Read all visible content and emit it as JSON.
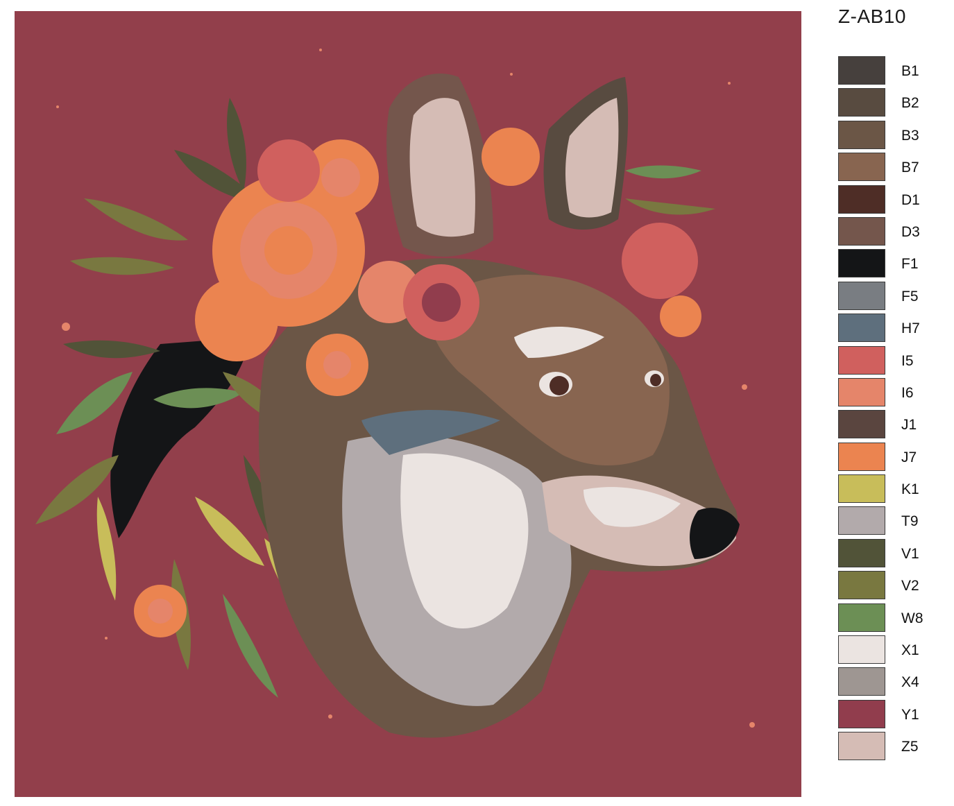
{
  "kit_code": "Z-AB10",
  "artwork": {
    "background_color": "#923f4b",
    "subject_icon": "wolf-with-flower-crown-illustration"
  },
  "palette": [
    {
      "code": "B1",
      "color": "#46403d"
    },
    {
      "code": "B2",
      "color": "#584b40"
    },
    {
      "code": "B3",
      "color": "#6b5646"
    },
    {
      "code": "B7",
      "color": "#886550"
    },
    {
      "code": "D1",
      "color": "#4e2d26"
    },
    {
      "code": "D3",
      "color": "#74564c"
    },
    {
      "code": "F1",
      "color": "#141517"
    },
    {
      "code": "F5",
      "color": "#797d82"
    },
    {
      "code": "H7",
      "color": "#5e6f7d"
    },
    {
      "code": "I5",
      "color": "#d0605e"
    },
    {
      "code": "I6",
      "color": "#e5856a"
    },
    {
      "code": "J1",
      "color": "#5a453f"
    },
    {
      "code": "J7",
      "color": "#eb8450"
    },
    {
      "code": "K1",
      "color": "#c8bd5a"
    },
    {
      "code": "T9",
      "color": "#b2aaab"
    },
    {
      "code": "V1",
      "color": "#515338"
    },
    {
      "code": "V2",
      "color": "#797840"
    },
    {
      "code": "W8",
      "color": "#6c8f55"
    },
    {
      "code": "X1",
      "color": "#ebe4e1"
    },
    {
      "code": "X4",
      "color": "#9e9692"
    },
    {
      "code": "Y1",
      "color": "#913d4d"
    },
    {
      "code": "Z5",
      "color": "#d5bcb5"
    }
  ]
}
